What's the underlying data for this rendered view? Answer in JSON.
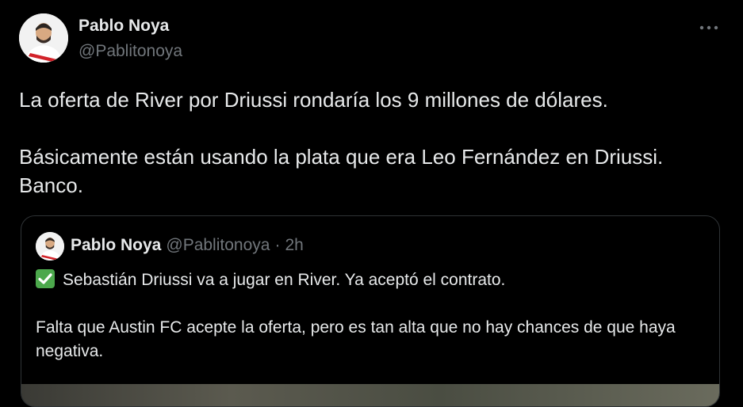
{
  "tweet": {
    "author": {
      "name": "Pablo Noya",
      "handle": "@Pablitonoya"
    },
    "paragraphs": [
      "La oferta de River por Driussi rondaría los 9 millones de dólares.",
      "Básicamente están usando la plata que era Leo Fernández en Driussi. Banco."
    ]
  },
  "quote": {
    "author": {
      "name": "Pablo Noya",
      "handle": "@Pablitonoya",
      "separator": "·",
      "time": "2h"
    },
    "paragraphs": [
      "Sebastián Driussi va a jugar en River. Ya aceptó el contrato.",
      "Falta que Austin FC acepte la oferta, pero es tan alta que no hay chances de que haya negativa."
    ],
    "leading_icon": "check-mark-button-icon"
  },
  "icons": {
    "more": "more-horizontal-icon",
    "avatar": "avatar"
  },
  "colors": {
    "background": "#000000",
    "primary_text": "#e7e9ea",
    "secondary_text": "#71767b",
    "border": "#2f3336",
    "check_green": "#4ca84c"
  }
}
